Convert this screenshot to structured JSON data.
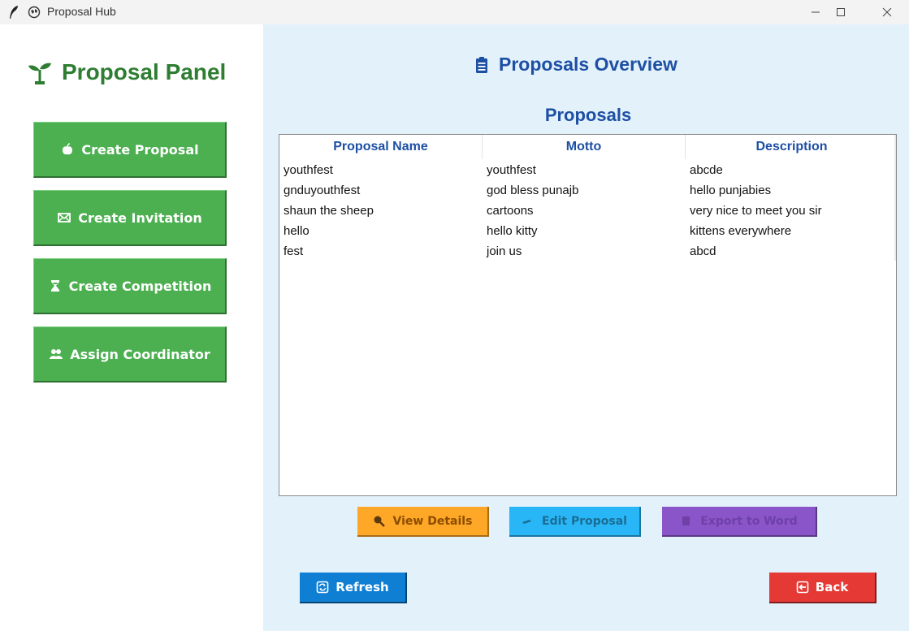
{
  "window": {
    "title": "Proposal Hub",
    "icons": [
      "feather-icon",
      "globe-icon"
    ]
  },
  "sidebar": {
    "title": "Proposal Panel",
    "title_icon": "sprout-icon",
    "accent": "#4caf50",
    "buttons": [
      {
        "label": "Create Proposal",
        "icon": "apple-icon"
      },
      {
        "label": "Create Invitation",
        "icon": "envelope-icon"
      },
      {
        "label": "Create Competition",
        "icon": "hourglass-icon"
      },
      {
        "label": "Assign Coordinator",
        "icon": "people-icon"
      }
    ]
  },
  "main": {
    "heading": "Proposals Overview",
    "heading_icon": "clipboard-icon",
    "table_title": "Proposals",
    "columns": [
      "Proposal Name",
      "Motto",
      "Description"
    ],
    "rows": [
      [
        "youthfest",
        "youthfest",
        "abcde"
      ],
      [
        "gnduyouthfest",
        "god bless punajb",
        "hello punjabies"
      ],
      [
        "shaun the sheep",
        "cartoons",
        "very nice to meet you sir"
      ],
      [
        "hello",
        "hello kitty",
        "kittens everywhere"
      ],
      [
        "fest",
        "join us",
        "abcd"
      ]
    ],
    "actions": {
      "view_label": "View Details",
      "edit_label": "Edit Proposal",
      "export_label": "Export to Word"
    },
    "refresh_label": "Refresh",
    "back_label": "Back",
    "colors": {
      "view": "#ffa726",
      "edit": "#29b6f6",
      "export": "#8a55c8",
      "refresh": "#0f7fd4",
      "back": "#e53935",
      "heading": "#1d4fa3",
      "background": "#e3f1fb"
    }
  }
}
